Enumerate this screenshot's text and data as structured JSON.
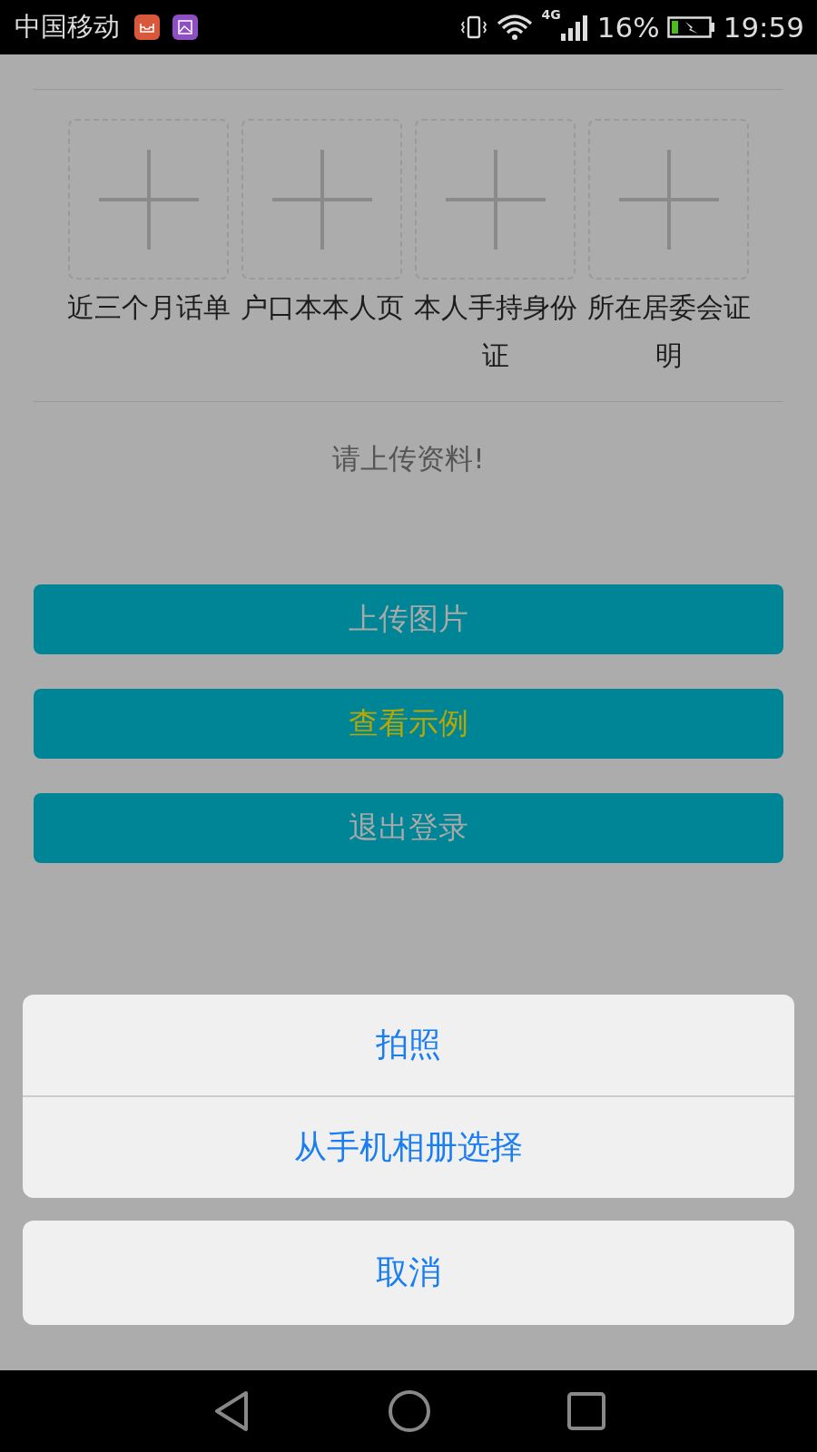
{
  "status_bar": {
    "carrier": "中国移动",
    "network": "4G",
    "battery": "16%",
    "time": "19:59"
  },
  "upload_tiles": [
    {
      "label": "近三个月话单"
    },
    {
      "label": "户口本本人页"
    },
    {
      "label": "本人手持身份证"
    },
    {
      "label": "所在居委会证明"
    }
  ],
  "hint": "请上传资料!",
  "buttons": [
    {
      "label": "上传图片",
      "kind": "plain"
    },
    {
      "label": "查看示例",
      "kind": "highlight"
    },
    {
      "label": "退出登录",
      "kind": "plain"
    }
  ],
  "action_sheet": {
    "options": [
      "拍照",
      "从手机相册选择"
    ],
    "cancel": "取消"
  }
}
